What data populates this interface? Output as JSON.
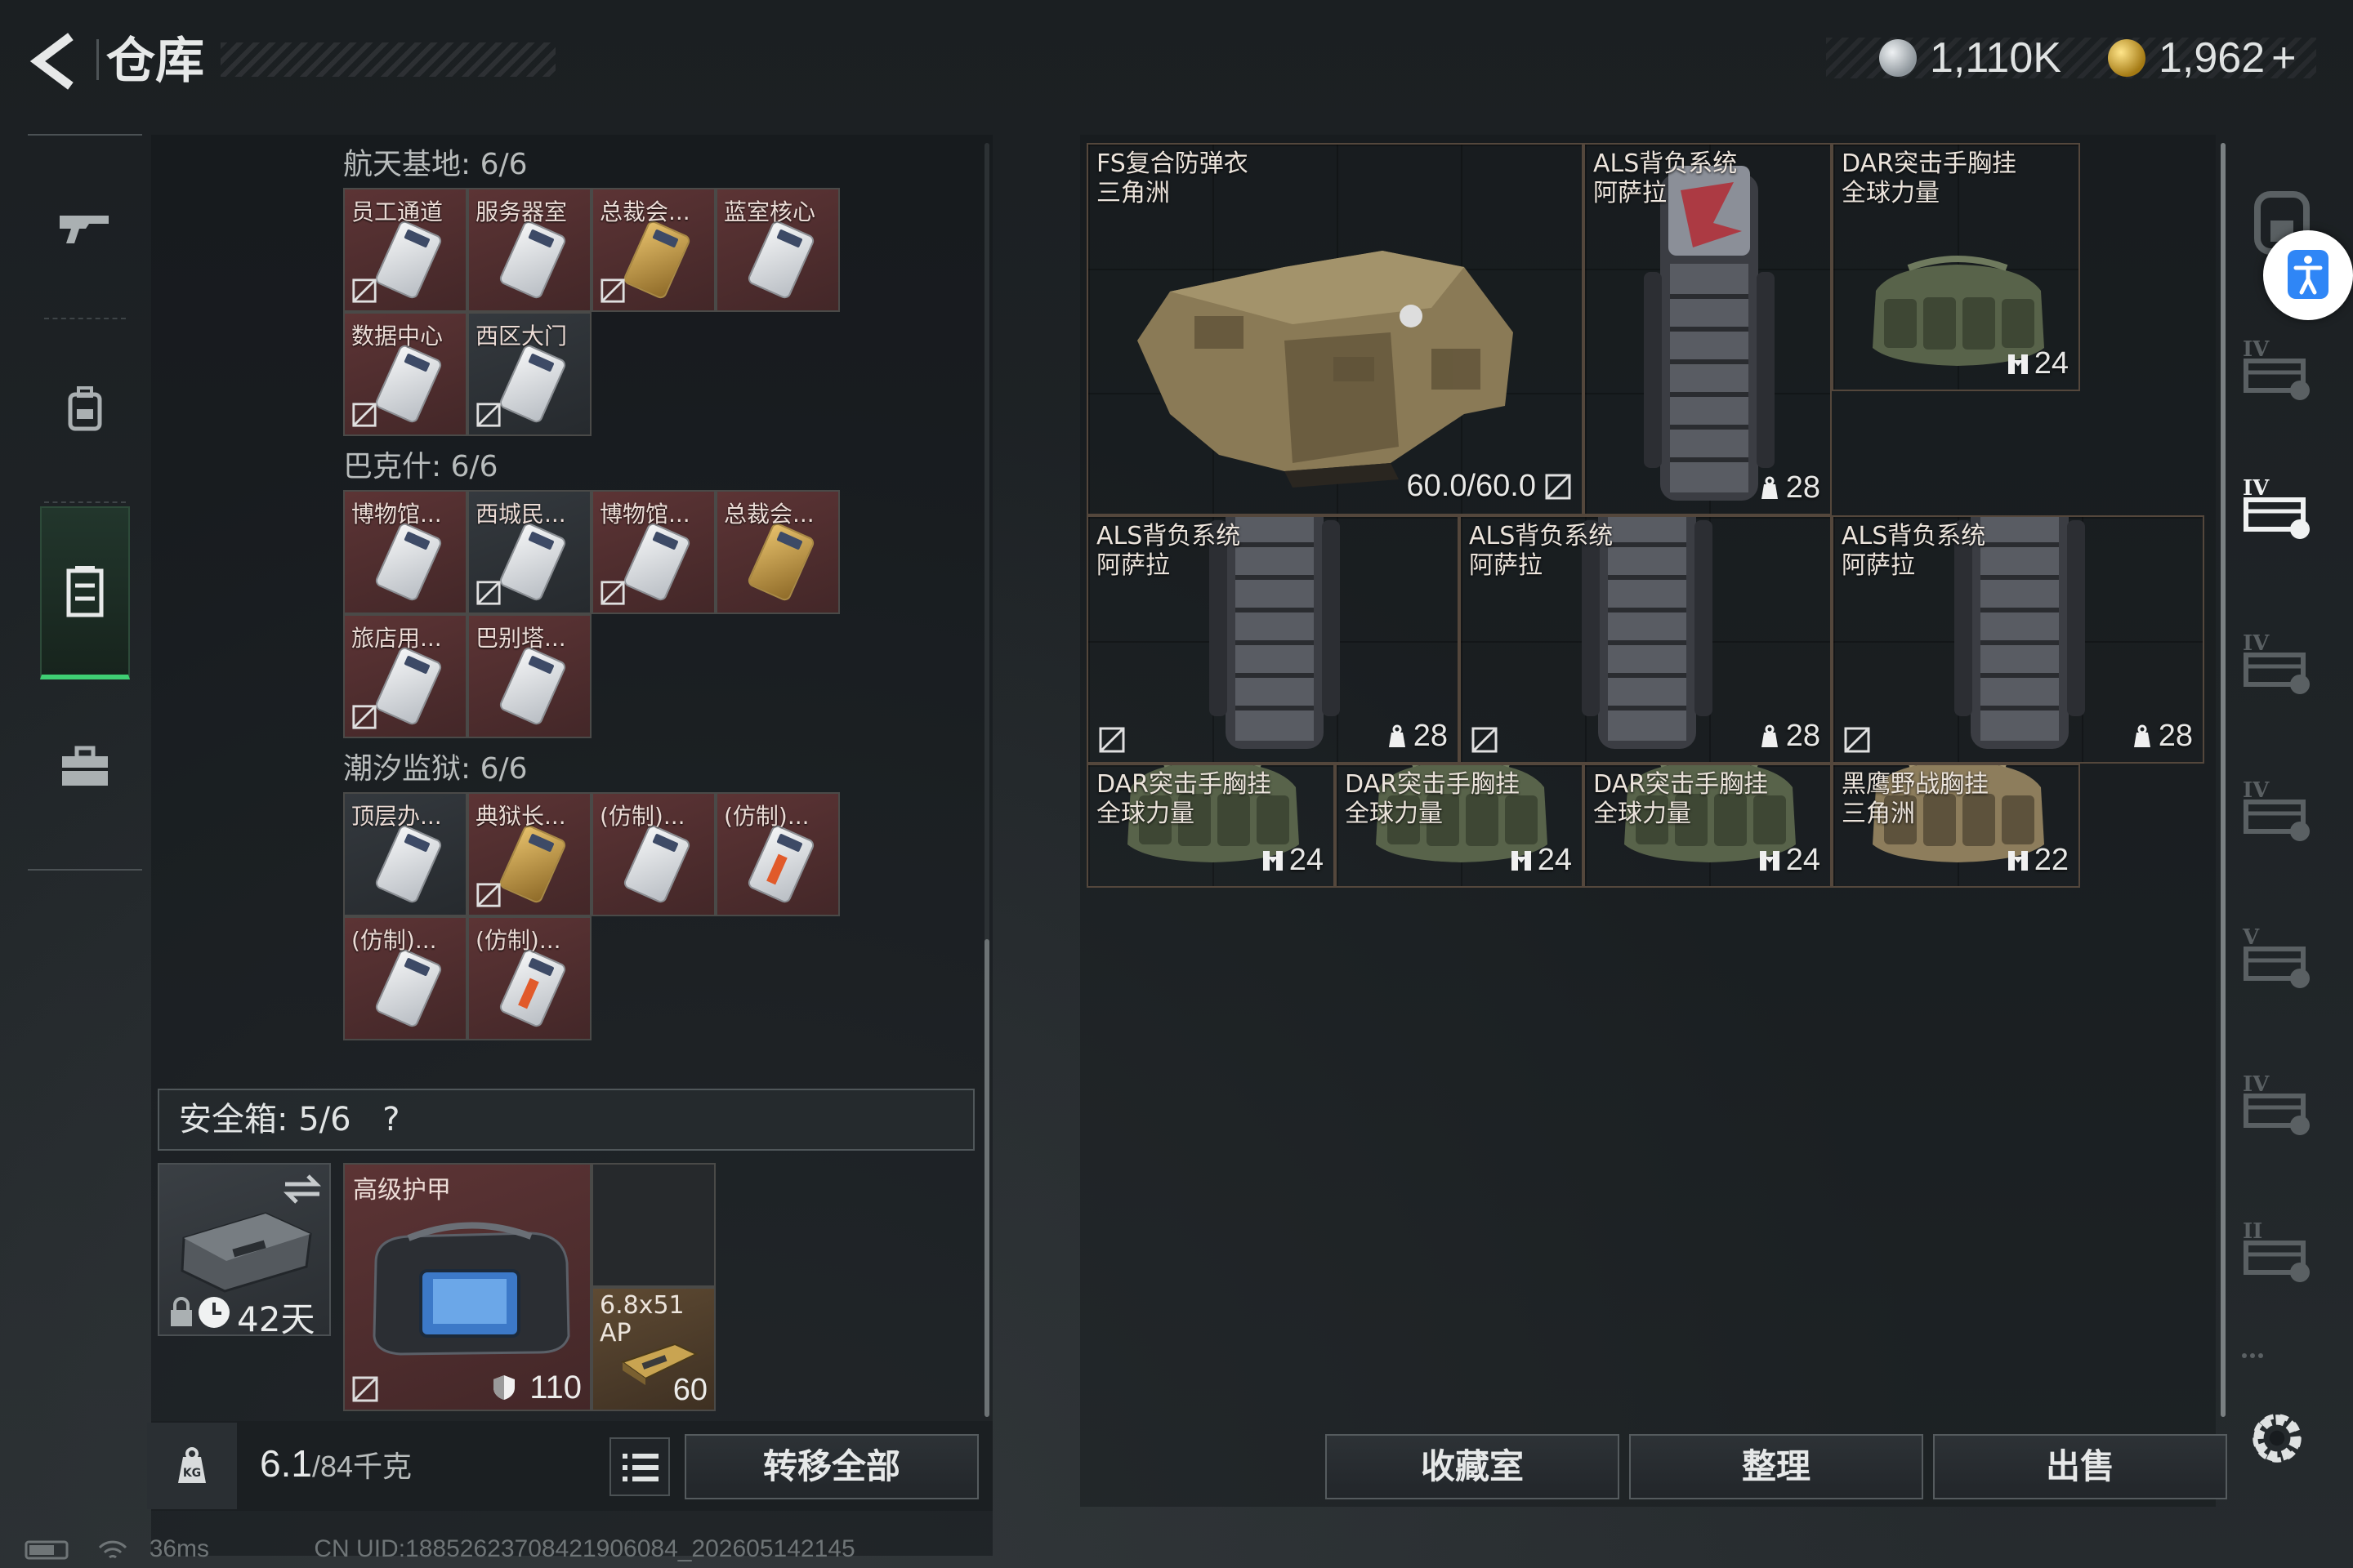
{
  "header": {
    "title": "仓库",
    "back_icon": "back-arrow-icon"
  },
  "currency": [
    {
      "icon": "silver-coin-icon",
      "value": "1,110K",
      "color": "#a9b0b6"
    },
    {
      "icon": "gold-coin-icon",
      "value": "1,962",
      "suffix": "+",
      "color": "#c9a63a"
    }
  ],
  "left_nav": [
    {
      "icon": "gun-icon",
      "active": false
    },
    {
      "icon": "backpack-icon",
      "active": false
    },
    {
      "icon": "storage-box-icon",
      "active": true
    },
    {
      "icon": "toolbox-icon",
      "active": false
    }
  ],
  "key_sections": [
    {
      "title": "航天基地: 6/6",
      "cards": [
        {
          "label": "员工通道",
          "style": "s",
          "rarity": "r",
          "no_trade": true
        },
        {
          "label": "服务器室",
          "style": "s",
          "rarity": "r",
          "no_trade": false
        },
        {
          "label": "总裁会...",
          "style": "g",
          "rarity": "r",
          "no_trade": true
        },
        {
          "label": "蓝室核心",
          "style": "s",
          "rarity": "r",
          "no_trade": false
        },
        {
          "label": "数据中心",
          "style": "s",
          "rarity": "r",
          "no_trade": true
        },
        {
          "label": "西区大门",
          "style": "s",
          "rarity": "n",
          "no_trade": true
        }
      ]
    },
    {
      "title": "巴克什: 6/6",
      "cards": [
        {
          "label": "博物馆...",
          "style": "s",
          "rarity": "r",
          "no_trade": false
        },
        {
          "label": "西城民...",
          "style": "s",
          "rarity": "n",
          "no_trade": true
        },
        {
          "label": "博物馆...",
          "style": "s",
          "rarity": "r",
          "no_trade": true
        },
        {
          "label": "总裁会...",
          "style": "g",
          "rarity": "r",
          "no_trade": false
        },
        {
          "label": "旅店用...",
          "style": "s",
          "rarity": "r",
          "no_trade": true
        },
        {
          "label": "巴别塔...",
          "style": "s",
          "rarity": "r",
          "no_trade": false
        }
      ]
    },
    {
      "title": "潮汐监狱: 6/6",
      "cards": [
        {
          "label": "顶层办...",
          "style": "s",
          "rarity": "n",
          "no_trade": false
        },
        {
          "label": "典狱长...",
          "style": "g",
          "rarity": "r",
          "no_trade": true
        },
        {
          "label": "(仿制)...",
          "style": "s",
          "rarity": "r",
          "no_trade": false
        },
        {
          "label": "(仿制)...",
          "style": "o",
          "rarity": "r",
          "no_trade": false
        },
        {
          "label": "(仿制)...",
          "style": "s",
          "rarity": "r",
          "no_trade": false
        },
        {
          "label": "(仿制)...",
          "style": "o",
          "rarity": "r",
          "no_trade": false
        }
      ]
    }
  ],
  "safe_box": {
    "title": "安全箱:  5/6",
    "help": "?",
    "timer": "42天",
    "armor": {
      "label": "高级护甲",
      "value": "110"
    },
    "ammo": {
      "label": "6.8x51\nAP",
      "value": "60"
    }
  },
  "weight": {
    "current": "6.1",
    "max": "/84千克"
  },
  "buttons": {
    "transfer_all": "转移全部",
    "collection": "收藏室",
    "sort": "整理",
    "sell": "出售"
  },
  "stash_items": [
    {
      "name": "FS复合防弹衣",
      "sub": "三角洲",
      "kind": "vest",
      "cap": "60.0/60.0",
      "cap_icon": "no-trade-icon"
    },
    {
      "name": "ALS背负系统",
      "sub": "阿萨拉",
      "kind": "pack",
      "cap": "28",
      "cap_icon": "weight-icon"
    },
    {
      "name": "DAR突击手胸挂",
      "sub": "全球力量",
      "kind": "rig",
      "cap": "24",
      "cap_icon": "capacity-icon"
    },
    {
      "name": "ALS背负系统",
      "sub": "阿萨拉",
      "kind": "pack",
      "cap": "28",
      "cap_icon": "weight-icon"
    },
    {
      "name": "ALS背负系统",
      "sub": "阿萨拉",
      "kind": "pack",
      "cap": "28",
      "cap_icon": "weight-icon"
    },
    {
      "name": "ALS背负系统",
      "sub": "阿萨拉",
      "kind": "pack",
      "cap": "28",
      "cap_icon": "weight-icon"
    },
    {
      "name": "DAR突击手胸挂",
      "sub": "全球力量",
      "kind": "rig",
      "cap": "24",
      "cap_icon": "capacity-icon"
    },
    {
      "name": "DAR突击手胸挂",
      "sub": "全球力量",
      "kind": "rig",
      "cap": "24",
      "cap_icon": "capacity-icon"
    },
    {
      "name": "DAR突击手胸挂",
      "sub": "全球力量",
      "kind": "rig",
      "cap": "24",
      "cap_icon": "capacity-icon"
    },
    {
      "name": "黑鹰野战胸挂",
      "sub": "三角洲",
      "kind": "rig2",
      "cap": "22",
      "cap_icon": "capacity-icon"
    }
  ],
  "right_sidebar": [
    "folder-icon",
    "tier-iv-stash-icon",
    "tier-iv-stash-active-icon",
    "tier-iv-stash-icon",
    "tier-iv-stash-icon",
    "tier-v-stash-icon",
    "tier-iv-folder-icon",
    "tier-ii-add-icon",
    "more-icon"
  ],
  "status": {
    "ping": "36ms",
    "uid": "CN UID:1885262370842190608​4_202605142145"
  }
}
